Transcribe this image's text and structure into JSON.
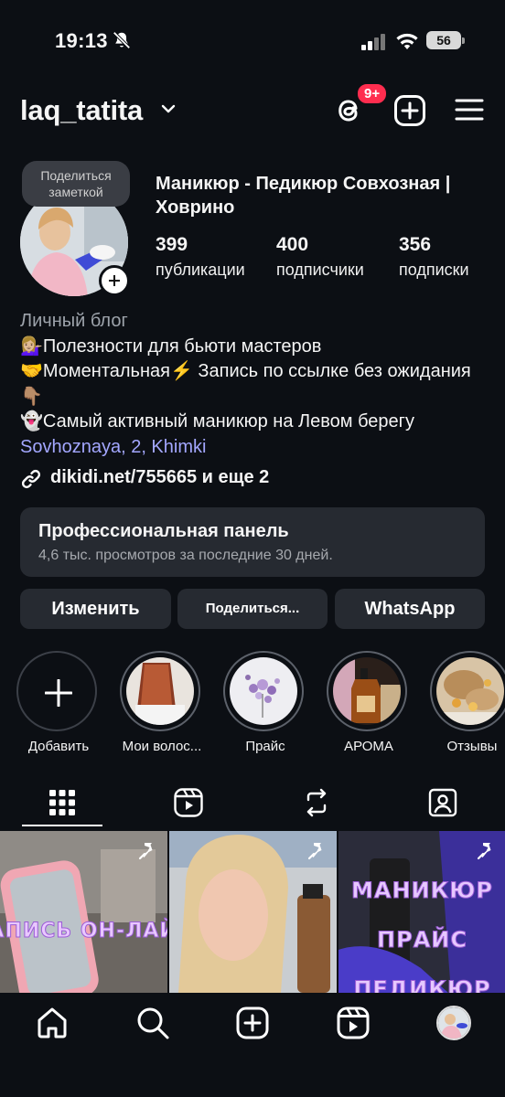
{
  "status_bar": {
    "time": "19:13",
    "battery": "56"
  },
  "header": {
    "username": "laq_tatita",
    "notification_badge": "9+"
  },
  "profile": {
    "note": "Поделиться заметкой",
    "name": "Маникюр - Педикюр  Совхозная | Ховрино",
    "stats": [
      {
        "value": "399",
        "label": "публикации"
      },
      {
        "value": "400",
        "label": "подписчики"
      },
      {
        "value": "356",
        "label": "подписки"
      }
    ]
  },
  "bio": {
    "category": "Личный блог",
    "lines": [
      "💁🏼‍♀️Полезности для бьюти мастеров",
      "🤝Моментальная⚡️ Запись по ссылке без ожидания  👇🏽",
      "👻Самый активный маникюр на Левом берегу"
    ],
    "location": "Sovhoznaya, 2, Khimki",
    "link": "dikidi.net/755665 и еще 2"
  },
  "pro_panel": {
    "title": "Профессиональная панель",
    "subtitle": "4,6 тыс. просмотров за последние 30 дней."
  },
  "buttons": {
    "edit": "Изменить",
    "share": "Поделиться...",
    "whatsapp": "WhatsApp"
  },
  "highlights": [
    {
      "label": "Добавить"
    },
    {
      "label": "Мои волос..."
    },
    {
      "label": "Прайс"
    },
    {
      "label": "АРОМА"
    },
    {
      "label": "Отзывы"
    }
  ],
  "grid": [
    {
      "text": "ЗАПИСЬ ОН-ЛАЙН",
      "pinned": true
    },
    {
      "text": "",
      "pinned": true
    },
    {
      "text": "МАНИКЮР ПРАЙС ПЕДИКЮР",
      "pinned": true
    }
  ],
  "colors": {
    "background": "#0c0f14",
    "surface": "#262a31",
    "badge": "#ff2d4f",
    "link": "#a3a7ff"
  }
}
